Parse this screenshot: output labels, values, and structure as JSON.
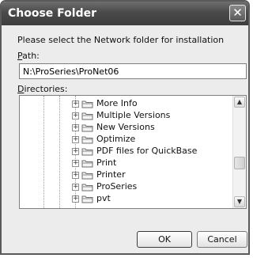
{
  "window": {
    "title": "Choose Folder",
    "close_glyph": "✕"
  },
  "instructions": "Please select the Network folder for installation",
  "path": {
    "label_underlined": "P",
    "label_rest": "ath:",
    "value": "N:\\ProSeries\\ProNet06"
  },
  "directories": {
    "label_underlined": "D",
    "label_rest": "irectories:",
    "items": [
      {
        "label": "More Info",
        "expander": "+",
        "icon": "folder-icon"
      },
      {
        "label": "Multiple Versions",
        "expander": "+",
        "icon": "folder-icon"
      },
      {
        "label": "New Versions",
        "expander": "+",
        "icon": "folder-icon"
      },
      {
        "label": "Optimize",
        "expander": "+",
        "icon": "folder-icon"
      },
      {
        "label": "PDF files for QuickBase",
        "expander": "+",
        "icon": "folder-icon"
      },
      {
        "label": "Print",
        "expander": "+",
        "icon": "folder-icon"
      },
      {
        "label": "Printer",
        "expander": "+",
        "icon": "folder-icon"
      },
      {
        "label": "ProSeries",
        "expander": "+",
        "icon": "folder-icon"
      },
      {
        "label": "pvt",
        "expander": "+",
        "icon": "folder-icon"
      }
    ],
    "scroll_up_glyph": "▲",
    "scroll_down_glyph": "▼"
  },
  "buttons": {
    "ok": "OK",
    "cancel": "Cancel"
  }
}
